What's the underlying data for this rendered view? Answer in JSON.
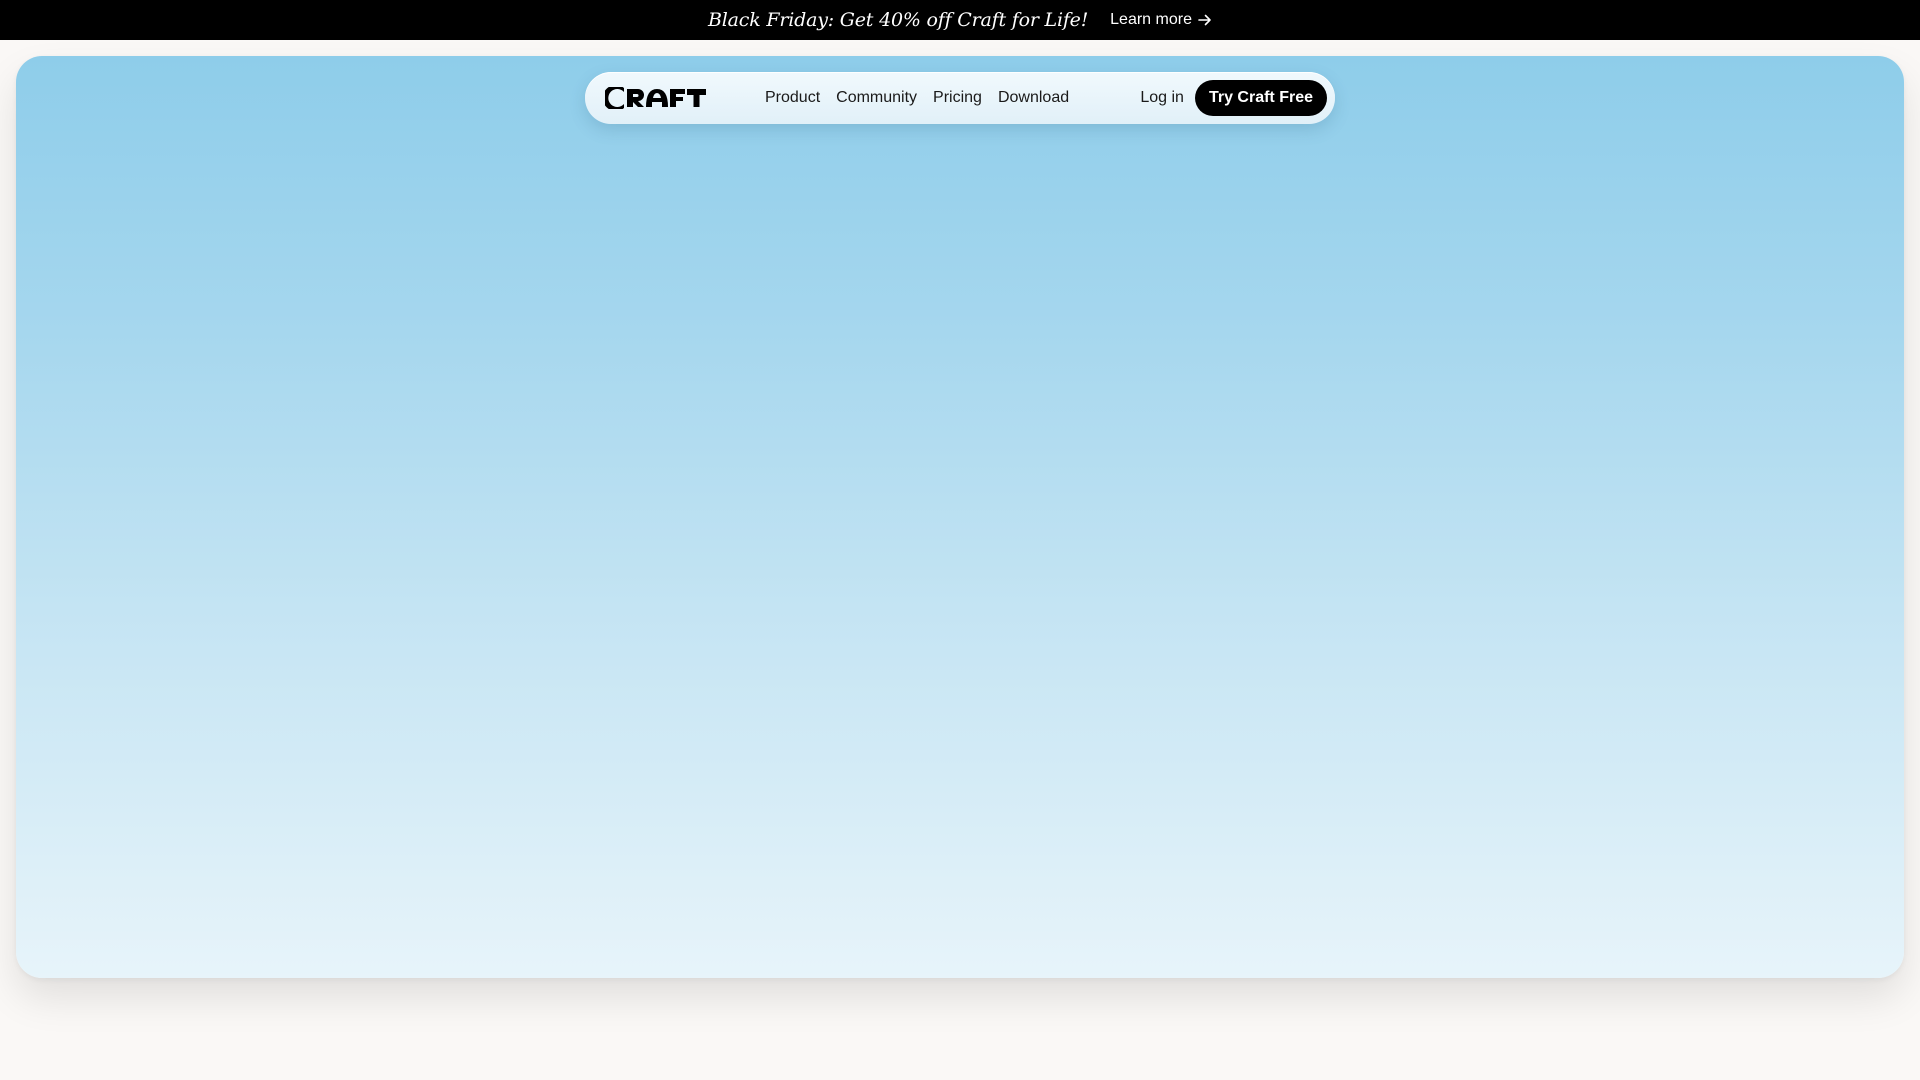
{
  "announcement": {
    "text": "Black Friday: Get 40% off Craft for Life!",
    "link_label": "Learn more",
    "link_icon": "arrow-right-icon"
  },
  "nav": {
    "logo_text": "CRAFT",
    "links": [
      "Product",
      "Community",
      "Pricing",
      "Download"
    ],
    "login_label": "Log in",
    "cta_label": "Try Craft Free"
  },
  "colors": {
    "announcement_bg": "#000000",
    "hero_top": "#8ecdea",
    "hero_bottom": "#e7f4fa",
    "cta_bg": "#000000",
    "page_bg": "#faf8f6"
  }
}
